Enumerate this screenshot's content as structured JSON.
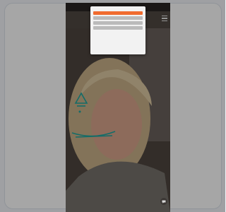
{
  "status_bar": {
    "time": "",
    "signal": ""
  },
  "app": {
    "brand_lines": [
      "",
      ""
    ]
  },
  "cookie_dialog": {
    "title": "",
    "body": "",
    "links": [
      "",
      "",
      ""
    ],
    "buttons": [
      "",
      "",
      "",
      ""
    ],
    "footer": ""
  },
  "colors": {
    "accent": "#f06b2f",
    "overlay_teal": "#1fa7a0",
    "photo_background": "#5a4f49"
  },
  "icons": [
    "hamburger-icon",
    "chat-icon"
  ]
}
